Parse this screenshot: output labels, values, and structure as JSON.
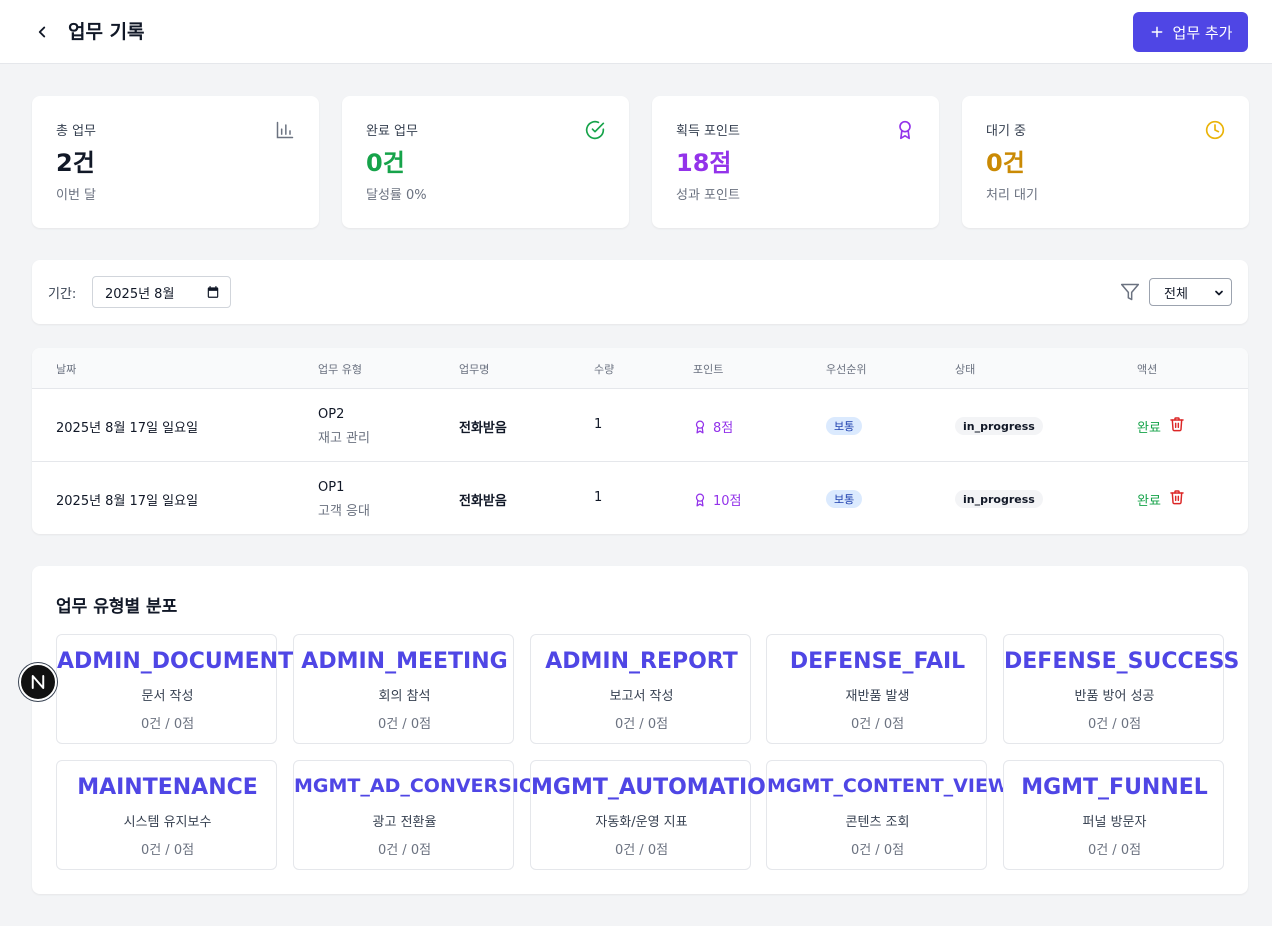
{
  "header": {
    "title": "업무 기록",
    "add_label": "업무 추가"
  },
  "stats": [
    {
      "label": "총 업무",
      "value": "2건",
      "sub": "이번 달",
      "icon": "bar-chart-icon",
      "color": "#111827",
      "icon_color": "#6b7280"
    },
    {
      "label": "완료 업무",
      "value": "0건",
      "sub": "달성률 0%",
      "icon": "check-circle-icon",
      "color": "#16a34a",
      "icon_color": "#16a34a"
    },
    {
      "label": "획득 포인트",
      "value": "18점",
      "sub": "성과 포인트",
      "icon": "award-icon",
      "color": "#9333ea",
      "icon_color": "#9333ea"
    },
    {
      "label": "대기 중",
      "value": "0건",
      "sub": "처리 대기",
      "icon": "clock-icon",
      "color": "#ca8a04",
      "icon_color": "#eab308"
    }
  ],
  "filter": {
    "period_label": "기간:",
    "month_value": "2025년 8월",
    "status_value": "전체"
  },
  "table": {
    "headers": [
      "날짜",
      "업무 유형",
      "업무명",
      "수량",
      "포인트",
      "우선순위",
      "상태",
      "액션"
    ],
    "rows": [
      {
        "date": "2025년 8월 17일 일요일",
        "code": "OP2",
        "type_name": "재고 관리",
        "name": "전화받음",
        "qty": "1",
        "points": "8점",
        "priority": "보통",
        "status": "in_progress",
        "action": "완료"
      },
      {
        "date": "2025년 8월 17일 일요일",
        "code": "OP1",
        "type_name": "고객 응대",
        "name": "전화받음",
        "qty": "1",
        "points": "10점",
        "priority": "보통",
        "status": "in_progress",
        "action": "완료"
      }
    ]
  },
  "distribution": {
    "title": "업무 유형별 분포",
    "types": [
      {
        "code": "ADMIN_DOCUMENT",
        "name": "문서 작성",
        "stat": "0건 / 0점"
      },
      {
        "code": "ADMIN_MEETING",
        "name": "회의 참석",
        "stat": "0건 / 0점"
      },
      {
        "code": "ADMIN_REPORT",
        "name": "보고서 작성",
        "stat": "0건 / 0점"
      },
      {
        "code": "DEFENSE_FAIL",
        "name": "재반품 발생",
        "stat": "0건 / 0점"
      },
      {
        "code": "DEFENSE_SUCCESS",
        "name": "반품 방어 성공",
        "stat": "0건 / 0점"
      },
      {
        "code": "MAINTENANCE",
        "name": "시스템 유지보수",
        "stat": "0건 / 0점"
      },
      {
        "code": "MGMT_AD_CONVERSION",
        "name": "광고 전환율",
        "stat": "0건 / 0점"
      },
      {
        "code": "MGMT_AUTOMATION",
        "name": "자동화/운영 지표",
        "stat": "0건 / 0점"
      },
      {
        "code": "MGMT_CONTENT_VIEWS",
        "name": "콘텐츠 조회",
        "stat": "0건 / 0점"
      },
      {
        "code": "MGMT_FUNNEL",
        "name": "퍼널 방문자",
        "stat": "0건 / 0점"
      }
    ]
  },
  "float_badge": {
    "letter": "N"
  }
}
